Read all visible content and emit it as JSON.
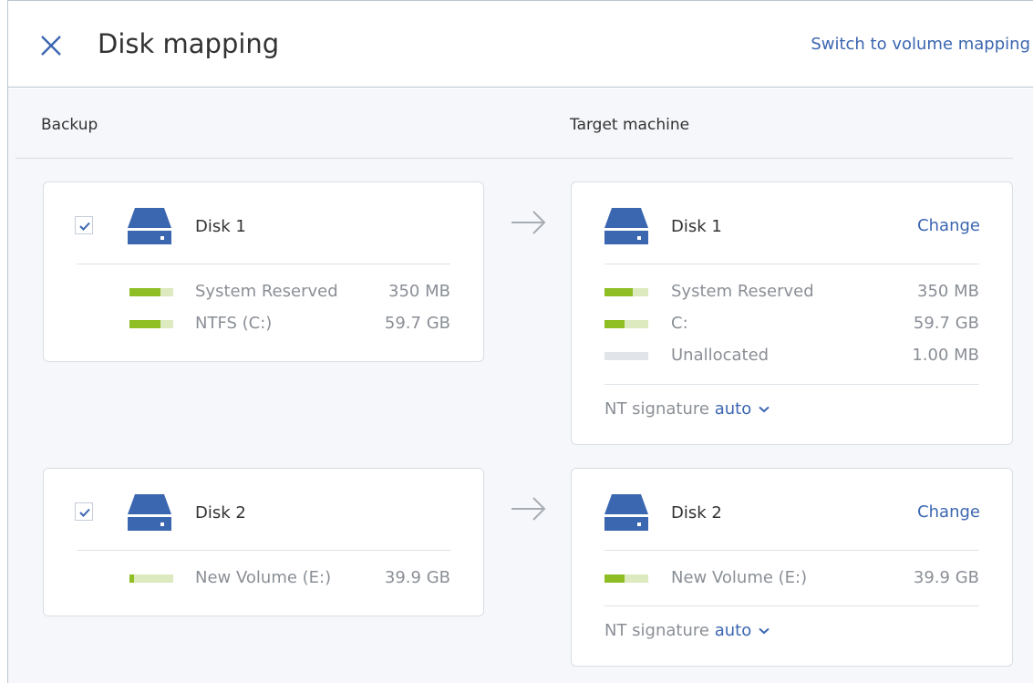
{
  "header": {
    "title": "Disk mapping",
    "switch_link": "Switch to volume mapping"
  },
  "columns": {
    "backup": "Backup",
    "target": "Target machine"
  },
  "colors": {
    "accent": "#3b66b0",
    "volume_used": "#8ebd24",
    "volume_free": "#dde9bf",
    "unallocated": "#e1e4e8"
  },
  "backup": {
    "disks": [
      {
        "name": "Disk 1",
        "checked": true,
        "volumes": [
          {
            "name": "System Reserved",
            "size": "350 MB",
            "fill": 0.7
          },
          {
            "name": "NTFS (C:)",
            "size": "59.7 GB",
            "fill": 0.7
          }
        ]
      },
      {
        "name": "Disk 2",
        "checked": true,
        "volumes": [
          {
            "name": "New Volume (E:)",
            "size": "39.9 GB",
            "fill": 0.1
          }
        ]
      }
    ]
  },
  "target": {
    "disks": [
      {
        "name": "Disk 1",
        "change_label": "Change",
        "volumes": [
          {
            "name": "System Reserved",
            "size": "350 MB",
            "fill": 0.65
          },
          {
            "name": "C:",
            "size": "59.7 GB",
            "fill": 0.45
          },
          {
            "name": "Unallocated",
            "size": "1.00 MB",
            "fill": 0
          }
        ],
        "nt_label": "NT signature",
        "nt_value": "auto"
      },
      {
        "name": "Disk 2",
        "change_label": "Change",
        "volumes": [
          {
            "name": "New Volume (E:)",
            "size": "39.9 GB",
            "fill": 0.45
          }
        ],
        "nt_label": "NT signature",
        "nt_value": "auto"
      }
    ]
  }
}
